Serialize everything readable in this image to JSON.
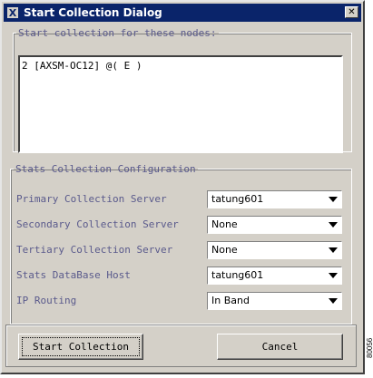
{
  "window": {
    "title": "Start Collection Dialog",
    "icon_letter": "X",
    "close_symbol": "✕"
  },
  "nodes": {
    "legend": "Start collection for these nodes:",
    "items": [
      "2 [AXSM-OC12] @( E )"
    ]
  },
  "stats": {
    "legend": "Stats Collection Configuration",
    "rows": [
      {
        "label": "Primary Collection Server",
        "value": "tatung601"
      },
      {
        "label": "Secondary Collection Server",
        "value": "None"
      },
      {
        "label": "Tertiary Collection Server",
        "value": "None"
      },
      {
        "label": "Stats DataBase Host",
        "value": "tatung601"
      },
      {
        "label": "IP Routing",
        "value": "In Band"
      }
    ]
  },
  "buttons": {
    "start": "Start Collection",
    "cancel": "Cancel"
  },
  "side_code": "80056"
}
